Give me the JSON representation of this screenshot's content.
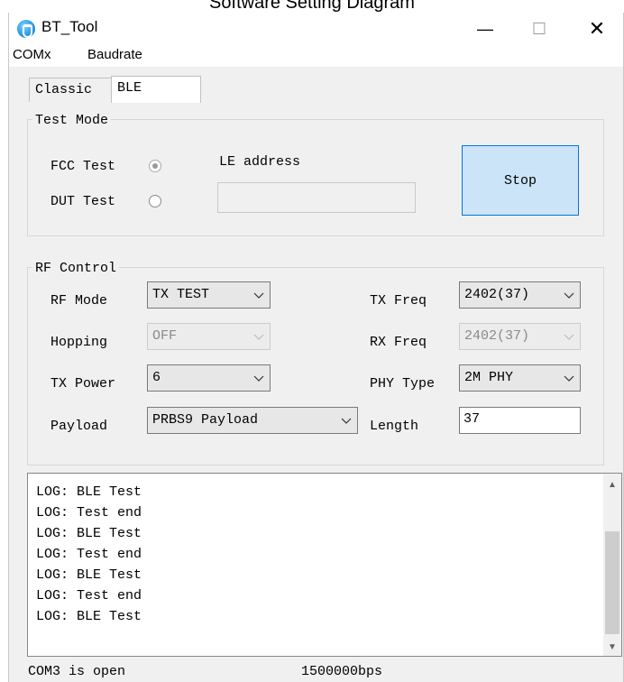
{
  "caption": "Software Setting Diagram",
  "window": {
    "title": "BT_Tool",
    "controls": {
      "minimize": "—",
      "maximize": "☐",
      "close": "✕"
    }
  },
  "menu": [
    "COMx",
    "Baudrate"
  ],
  "tabs": [
    {
      "label": "Classic",
      "active": false
    },
    {
      "label": "BLE",
      "active": true
    }
  ],
  "test_mode": {
    "legend": "Test Mode",
    "fcc_label": "FCC Test",
    "fcc_selected": true,
    "dut_label": "DUT Test",
    "dut_selected": false,
    "le_address_label": "LE address",
    "le_address_value": "",
    "stop_label": "Stop"
  },
  "rf_control": {
    "legend": "RF Control",
    "rf_mode": {
      "label": "RF Mode",
      "value": "TX TEST"
    },
    "hopping": {
      "label": "Hopping",
      "value": "OFF",
      "disabled": true
    },
    "tx_power": {
      "label": "TX Power",
      "value": "6"
    },
    "payload": {
      "label": "Payload",
      "value": "PRBS9 Payload"
    },
    "tx_freq": {
      "label": "TX Freq",
      "value": "2402(37)"
    },
    "rx_freq": {
      "label": "RX Freq",
      "value": "2402(37)",
      "disabled": true
    },
    "phy_type": {
      "label": "PHY Type",
      "value": "2M PHY"
    },
    "length": {
      "label": "Length",
      "value": "37"
    }
  },
  "log": {
    "lines": [
      "LOG: BLE Test",
      "LOG: Test end",
      "LOG: BLE Test",
      "LOG: Test end",
      "LOG: BLE Test",
      "LOG: Test end",
      "LOG: BLE Test"
    ]
  },
  "status": {
    "port": "COM3 is open",
    "baud": "1500000bps"
  },
  "colors": {
    "accent": "#0078d7",
    "button_fill": "#cce4f7",
    "window_bg": "#f0f0f0"
  },
  "icons": [
    "app-icon",
    "radio-icon",
    "chevron-down-icon",
    "scroll-up-icon",
    "scroll-down-icon"
  ]
}
